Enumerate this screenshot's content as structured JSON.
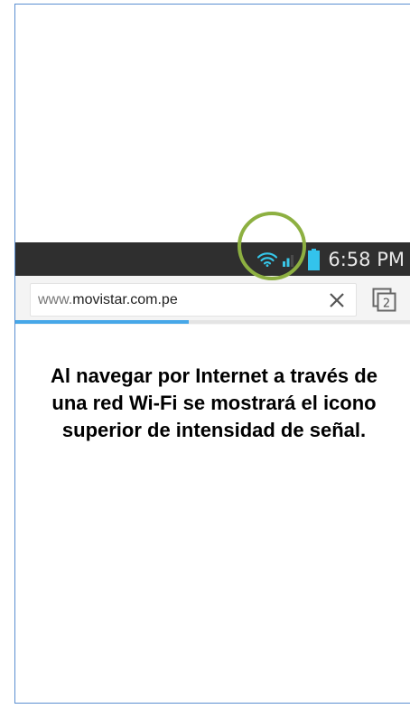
{
  "status_bar": {
    "time": "6:58 PM",
    "icons": [
      "wifi-icon",
      "signal-icon",
      "battery-icon"
    ]
  },
  "browser": {
    "url_prefix": "www.",
    "url_domain": "movistar.com.pe",
    "tab_count": "2",
    "load_progress": 0.44,
    "icons": [
      "clear-icon",
      "tabs-icon"
    ]
  },
  "caption": {
    "text": "Al navegar por Internet a través de una red Wi-Fi se mostrará el icono superior de intensidad de señal."
  },
  "colors": {
    "wifi": "#35c6e8",
    "signal": "#3ac6e6",
    "battery": "#33c3ec",
    "highlight_ring": "#8db041",
    "progress": "#46a7e8",
    "frame_border": "#5b8fd1",
    "status_bar": "#2f2f2f"
  }
}
